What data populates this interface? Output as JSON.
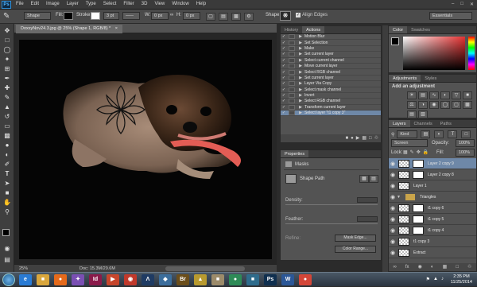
{
  "app": {
    "logo": "Ps"
  },
  "menubar": {
    "items": [
      "File",
      "Edit",
      "Image",
      "Layer",
      "Type",
      "Select",
      "Filter",
      "3D",
      "View",
      "Window",
      "Help"
    ]
  },
  "options": {
    "mode_value": "Shape",
    "fill_label": "Fill:",
    "stroke_label": "Stroke:",
    "stroke_value": "3 pt",
    "w_label": "W:",
    "w_value": "0 px",
    "h_label": "H:",
    "h_value": "0 px",
    "shape_label": "Shape:",
    "align_edges": "Align Edges",
    "workspace": "Essentials"
  },
  "document": {
    "tab_title": "DoxxyNov24.3.jpg @ 25% (Shape 1, RGB/8) *",
    "zoom": "25%",
    "doc_info": "Doc: 15.3M/29.6M"
  },
  "actions_panel": {
    "tabs": [
      "History",
      "Actions"
    ],
    "rows": [
      "Motion Blur",
      "Set Selection",
      "Make",
      "Set current layer",
      "Select current channel",
      "Move current layer",
      "Select RGB channel",
      "Set current layer",
      "Layer Via Copy",
      "Select mask channel",
      "Invert",
      "Select RGB channel",
      "Transform current layer",
      "Select layer \"t1 copy 3\""
    ]
  },
  "properties_panel": {
    "title": "Properties",
    "masks_label": "Masks",
    "shape_path": "Shape Path",
    "density_label": "Density:",
    "feather_label": "Feather:",
    "refine_label": "Refine:",
    "mask_edge_button": "Mask Edge...",
    "color_range_button": "Color Range..."
  },
  "color_panel": {
    "tabs": [
      "Color",
      "Swatches"
    ],
    "hue": "#e63232"
  },
  "adjustments_panel": {
    "tabs": [
      "Adjustments",
      "Styles"
    ],
    "title": "Add an adjustment"
  },
  "layers_panel": {
    "tabs": [
      "Layers",
      "Channels",
      "Paths"
    ],
    "kind": "Kind",
    "blend": "Screen",
    "opacity_label": "Opacity:",
    "opacity_value": "100%",
    "lock_label": "Lock:",
    "fill_label": "Fill:",
    "fill_value": "100%",
    "layers": [
      {
        "name": "Layer 2 copy 9",
        "selected": true,
        "mask": true
      },
      {
        "name": "Layer 2 copy 8",
        "selected": false,
        "mask": true
      },
      {
        "name": "Layer 1",
        "selected": false,
        "mask": false
      },
      {
        "name": "Triangles",
        "selected": false,
        "group": true
      },
      {
        "name": "t1 copy 6",
        "selected": false,
        "mask": true
      },
      {
        "name": "t1 copy 5",
        "selected": false,
        "mask": true
      },
      {
        "name": "t1 copy 4",
        "selected": false,
        "mask": true
      },
      {
        "name": "t1 copy 3",
        "selected": false,
        "mask": false
      },
      {
        "name": "Extract",
        "selected": false,
        "mask": false
      }
    ]
  },
  "taskbar": {
    "apps": [
      {
        "icon": "ie-icon",
        "label": "e",
        "color": "#2a7bd4"
      },
      {
        "icon": "folder-icon",
        "label": "■",
        "color": "#d9a63c"
      },
      {
        "icon": "firefox-icon",
        "label": "●",
        "color": "#e56a1b"
      },
      {
        "icon": "app-icon",
        "label": "✦",
        "color": "#7a4fb3"
      },
      {
        "icon": "indesign-icon",
        "label": "Id",
        "color": "#8a1a4a"
      },
      {
        "icon": "media-icon",
        "label": "▶",
        "color": "#c7462c"
      },
      {
        "icon": "camera-icon",
        "label": "◉",
        "color": "#c0392b"
      },
      {
        "icon": "acrobat-icon",
        "label": "Λ",
        "color": "#1f3b63"
      },
      {
        "icon": "app2-icon",
        "label": "◆",
        "color": "#3c6e9c"
      },
      {
        "icon": "bridge-icon",
        "label": "Br",
        "color": "#6b4e1b"
      },
      {
        "icon": "app3-icon",
        "label": "▲",
        "color": "#b89a2f"
      },
      {
        "icon": "app4-icon",
        "label": "■",
        "color": "#9c8b6a"
      },
      {
        "icon": "app5-icon",
        "label": "●",
        "color": "#2e8b57"
      },
      {
        "icon": "app6-icon",
        "label": "■",
        "color": "#2f6c8c"
      },
      {
        "icon": "photoshop-icon",
        "label": "Ps",
        "color": "#0f2f4f"
      },
      {
        "icon": "word-icon",
        "label": "W",
        "color": "#2b5797"
      },
      {
        "icon": "chrome-icon",
        "label": "●",
        "color": "#d44638"
      }
    ],
    "time": "2:35 PM",
    "date": "11/25/2014"
  }
}
